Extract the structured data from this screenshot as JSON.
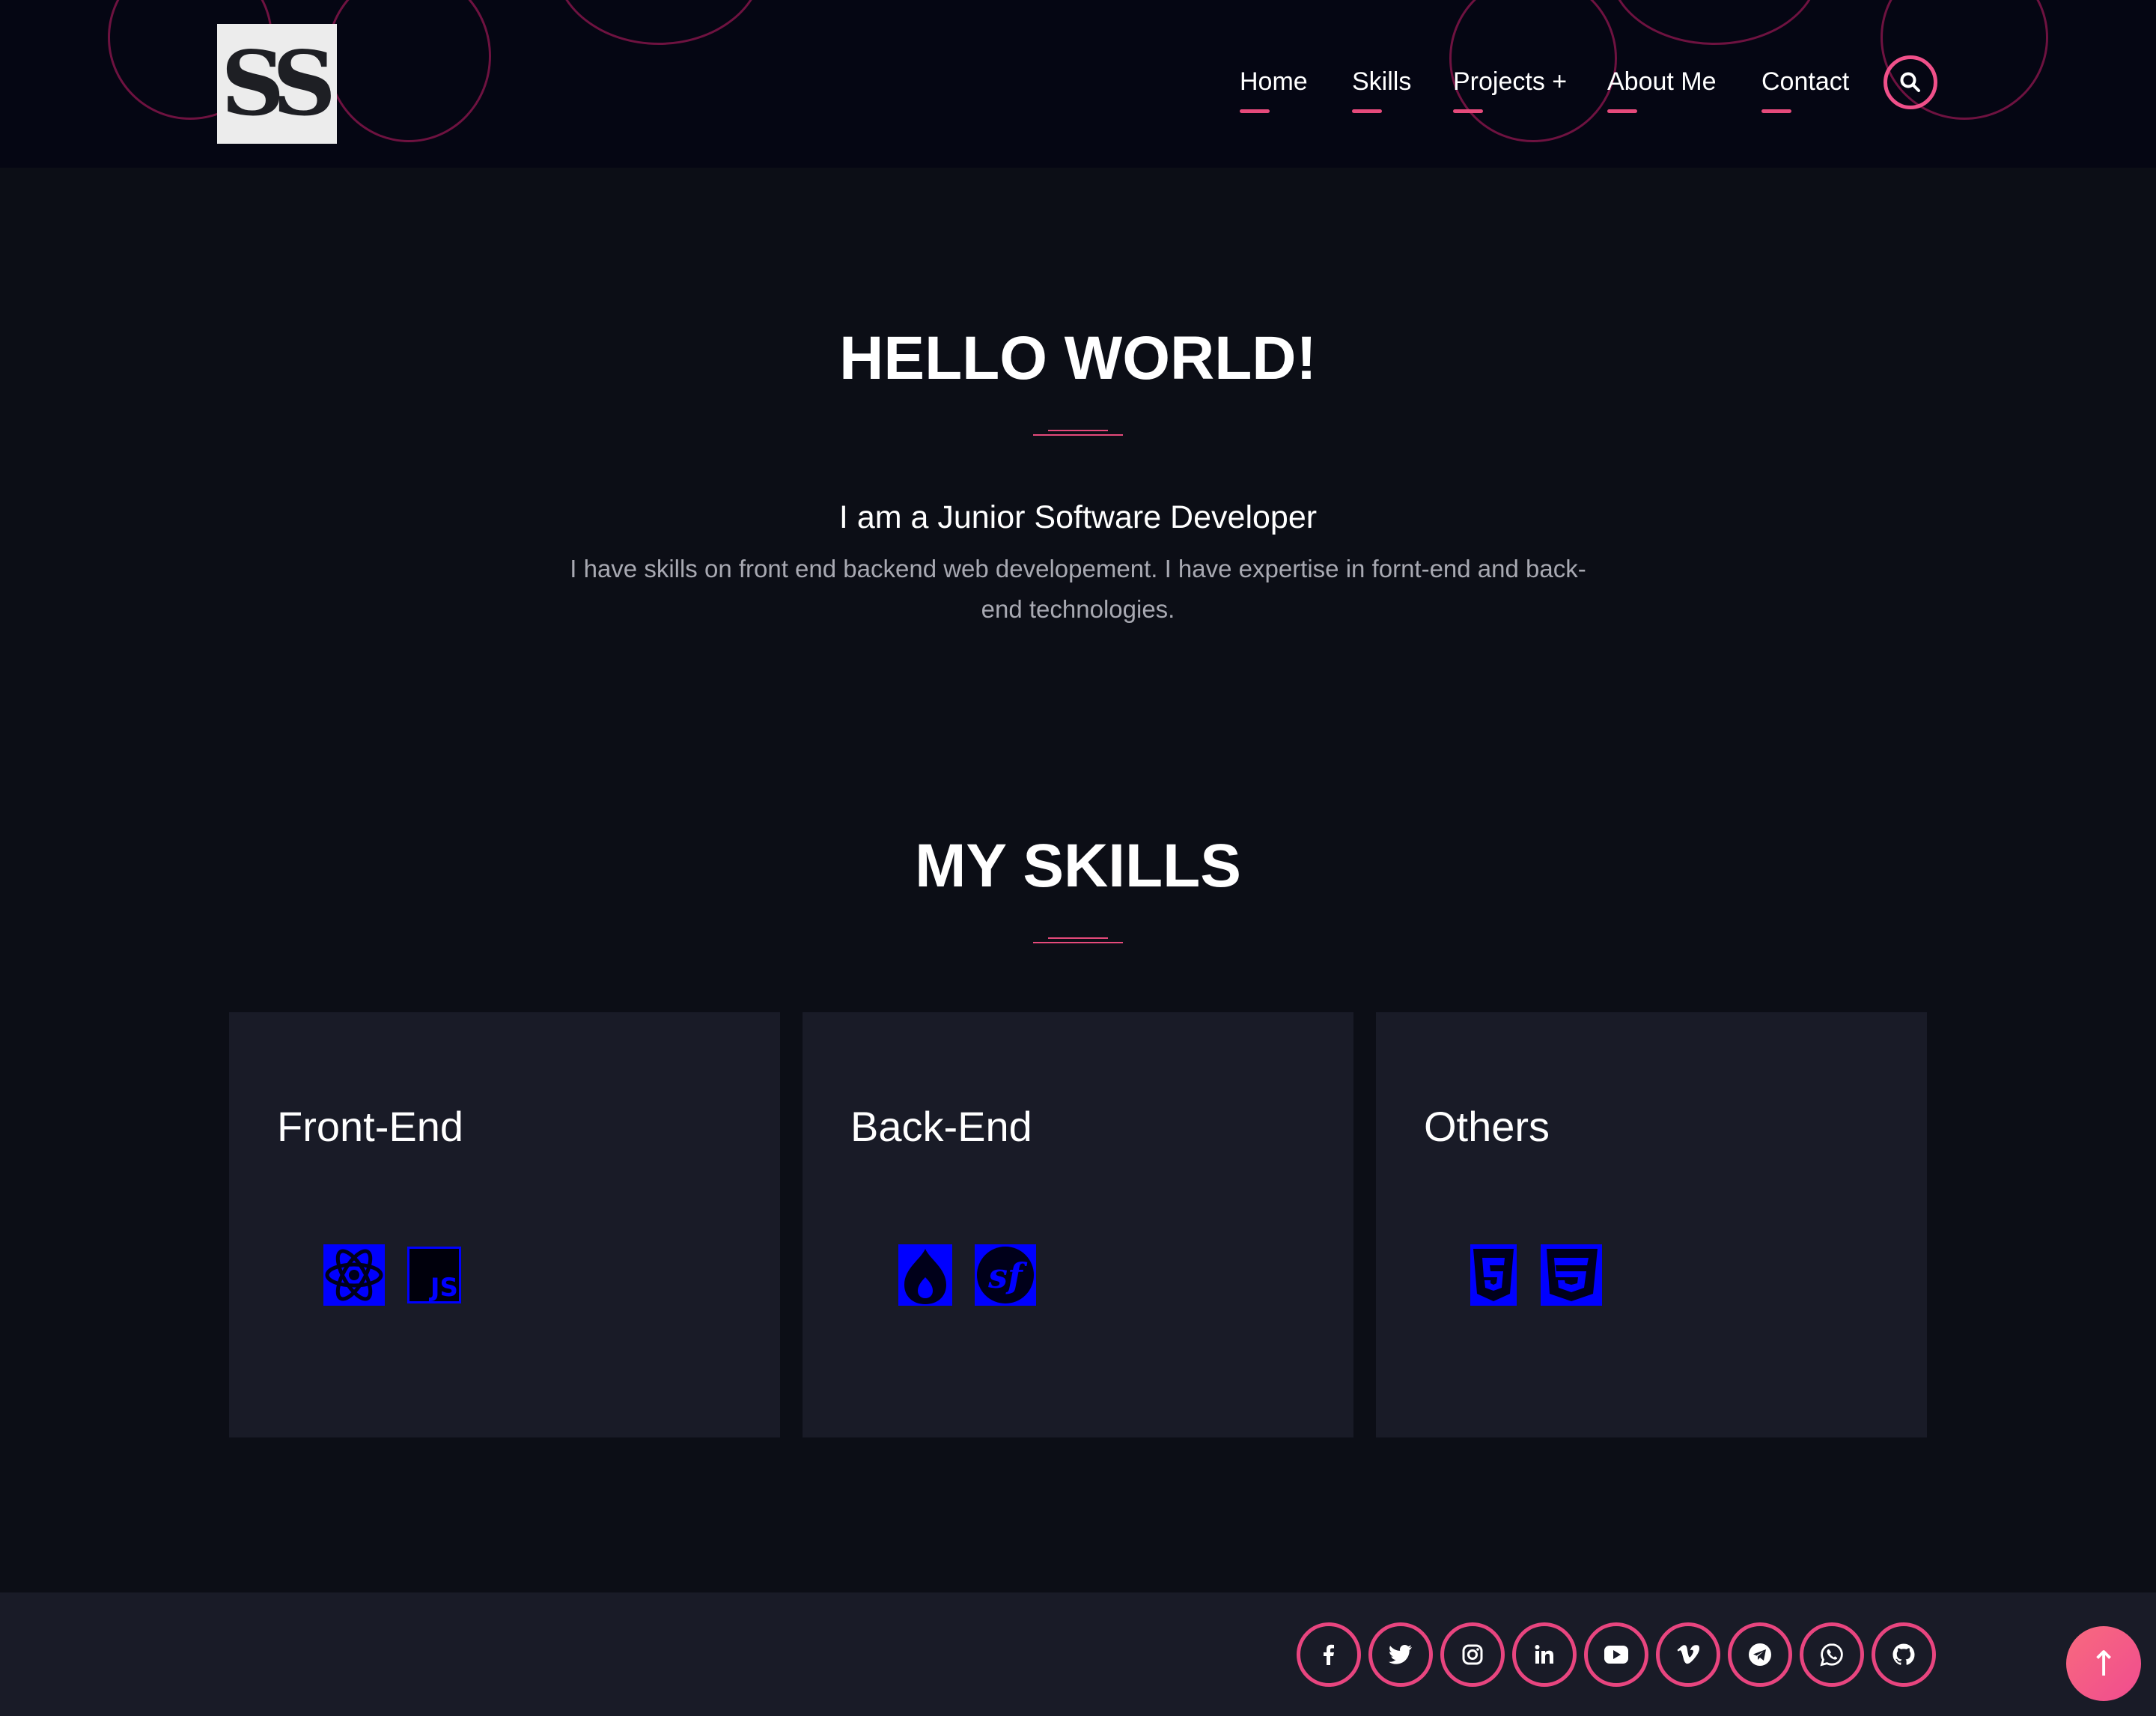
{
  "header": {
    "logo_text": "SS",
    "nav": [
      "Home",
      "Skills",
      "Projects +",
      "About Me",
      "Contact"
    ],
    "search_icon": "search-icon"
  },
  "hero": {
    "title": "HELLO WORLD!",
    "subtitle": "I am a Junior Software Developer",
    "description": "I have skills on front end backend web developement. I have expertise in fornt-end and back-end technologies."
  },
  "skills": {
    "title": "MY SKILLS",
    "cards": [
      {
        "title": "Front-End",
        "icons": [
          "react-icon",
          "javascript-icon"
        ]
      },
      {
        "title": "Back-End",
        "icons": [
          "drupal-icon",
          "symfony-icon"
        ]
      },
      {
        "title": "Others",
        "icons": [
          "html5-icon",
          "css3-icon"
        ]
      }
    ]
  },
  "footer": {
    "social_icons": [
      "facebook-icon",
      "twitter-icon",
      "instagram-icon",
      "linkedin-icon",
      "youtube-icon",
      "vimeo-icon",
      "telegram-icon",
      "whatsapp-icon",
      "github-icon"
    ],
    "back_to_top": "↑"
  },
  "colors": {
    "header_bg": "#050613",
    "page_bg": "#0c0e16",
    "card_bg": "#191b27",
    "accent_pink": "#e64a7b",
    "icon_blue": "#0000ff"
  }
}
